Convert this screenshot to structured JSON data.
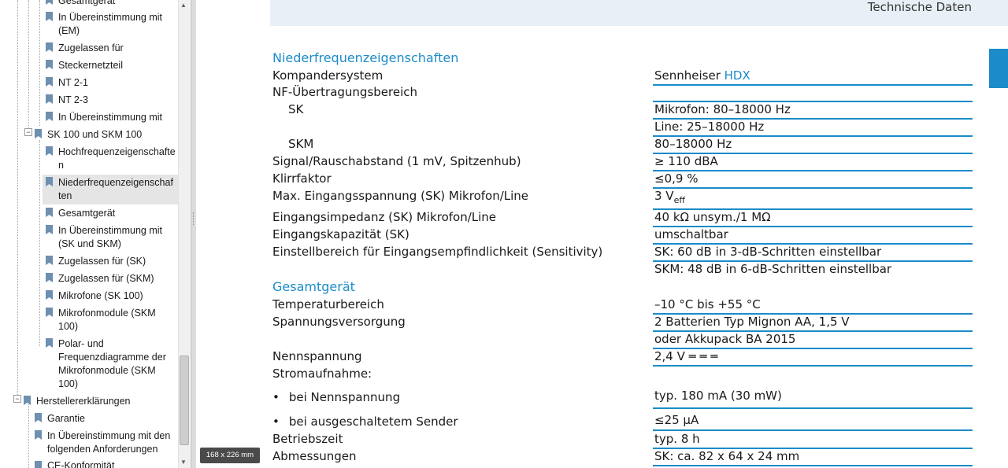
{
  "sidebar": {
    "items": [
      {
        "label": "Gesamtgerät"
      },
      {
        "label_lines": [
          "In Übereinstimmung mit",
          "(EM)"
        ]
      },
      {
        "label": "Zugelassen für"
      },
      {
        "label": "Steckernetzteil"
      },
      {
        "label": "NT 2-1"
      },
      {
        "label": "NT 2-3"
      },
      {
        "label": "In Übereinstimmung mit"
      },
      {
        "label": "SK 100 und SKM 100"
      },
      {
        "label_lines": [
          "Hochfrequenzeigenschafte",
          "n"
        ]
      },
      {
        "label_lines": [
          "Niederfrequenzeigenschaf",
          "ten"
        ]
      },
      {
        "label": "Gesamtgerät"
      },
      {
        "label_lines": [
          "In Übereinstimmung mit",
          "(SK und SKM)"
        ]
      },
      {
        "label": "Zugelassen für (SK)"
      },
      {
        "label": "Zugelassen für (SKM)"
      },
      {
        "label": "Mikrofone (SK 100)"
      },
      {
        "label_lines": [
          "Mikrofonmodule (SKM",
          "100)"
        ]
      },
      {
        "label_lines": [
          "Polar- und",
          "Frequenzdiagramme der",
          "Mikrofonmodule (SKM",
          "100)"
        ]
      },
      {
        "label": "Herstellererklärungen"
      },
      {
        "label": "Garantie"
      },
      {
        "label_lines": [
          "In Übereinstimmung mit den",
          "folgenden Anforderungen"
        ]
      },
      {
        "label": "CE-Konformität"
      }
    ]
  },
  "size_badge": "168 x 226 mm",
  "page": {
    "header_title": "Technische Daten",
    "section1": {
      "title": "Niederfrequenzeigenschaften",
      "rows": [
        {
          "label": "Kompandersystem",
          "value_prefix": "Sennheiser ",
          "value_highlight": "HDX"
        },
        {
          "label": "NF-Übertragungsbereich"
        },
        {
          "label": "SK",
          "value": "Mikrofon: 80–18000 Hz"
        },
        {
          "value": "Line: 25–18000 Hz"
        },
        {
          "label": "SKM",
          "value": "80–18000 Hz"
        },
        {
          "label": "Signal/Rauschabstand (1 mV, Spitzenhub)",
          "value": "≥ 110 dBA"
        },
        {
          "label": "Klirrfaktor",
          "value": "≤0,9 %"
        },
        {
          "label": "Max. Eingangsspannung (SK) Mikrofon/Line",
          "value_main": "3 V",
          "value_sub": "eff"
        },
        {
          "label": "Eingangsimpedanz (SK) Mikrofon/Line",
          "value": "40 kΩ  unsym./1 MΩ"
        },
        {
          "label": "Eingangskapazität (SK)",
          "value": "umschaltbar"
        },
        {
          "label": "Einstellbereich für Eingangsempfindlichkeit (Sensitivity)",
          "value": "SK: 60 dB in 3-dB-Schritten einstellbar"
        },
        {
          "value": "SKM: 48 dB in 6-dB-Schritten einstellbar"
        }
      ]
    },
    "section2": {
      "title": "Gesamtgerät",
      "rows": [
        {
          "label": "Temperaturbereich",
          "value": "–10 °C bis +55 °C"
        },
        {
          "label": "Spannungsversorgung",
          "value": "2 Batterien Typ Mignon AA, 1,5 V"
        },
        {
          "value": "oder Akkupack BA 2015"
        },
        {
          "label": "Nennspannung",
          "value": "2,4 V ═ ═ ═"
        },
        {
          "label": "Stromaufnahme:"
        },
        {
          "bullet": "•",
          "label": "bei Nennspannung",
          "value": "typ. 180 mA (30 mW)"
        },
        {
          "bullet": "•",
          "label": "bei ausgeschaltetem Sender",
          "value": "≤25 µA"
        },
        {
          "label": "Betriebszeit",
          "value": "typ. 8 h"
        },
        {
          "label": "Abmessungen",
          "value": "SK: ca. 82 x 64 x 24 mm"
        }
      ]
    }
  }
}
